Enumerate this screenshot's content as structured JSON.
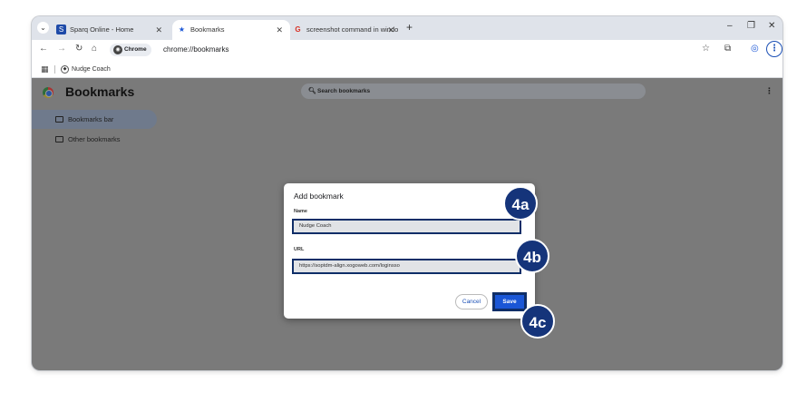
{
  "browser": {
    "tabs": [
      {
        "title": "Sparq Online - Home",
        "favicon": "sparq-favicon",
        "active": false
      },
      {
        "title": "Bookmarks",
        "favicon": "star-icon",
        "active": true
      },
      {
        "title": "screenshot command in windo",
        "favicon": "google-favicon",
        "active": false
      }
    ],
    "chip_label": "Chrome",
    "url": "chrome://bookmarks",
    "bookmarks_bar": [
      {
        "label": "Nudge Coach",
        "icon": "globe-icon"
      }
    ]
  },
  "page": {
    "title": "Bookmarks",
    "search_placeholder": "Search bookmarks",
    "sidebar": [
      {
        "label": "Bookmarks bar",
        "selected": true
      },
      {
        "label": "Other bookmarks",
        "selected": false
      }
    ]
  },
  "dialog": {
    "title": "Add bookmark",
    "name_label": "Name",
    "name_value": "Nudge Coach",
    "url_label": "URL",
    "url_value": "https://soptdm-align.xogoweb.com/loginsso",
    "cancel_label": "Cancel",
    "save_label": "Save"
  },
  "callouts": {
    "a": "4a",
    "b": "4b",
    "c": "4c"
  },
  "colors": {
    "callout": "#15347a",
    "highlight_border": "#0f2e68",
    "save_button": "#1a56d6",
    "overlay": "#7a7a7a"
  }
}
